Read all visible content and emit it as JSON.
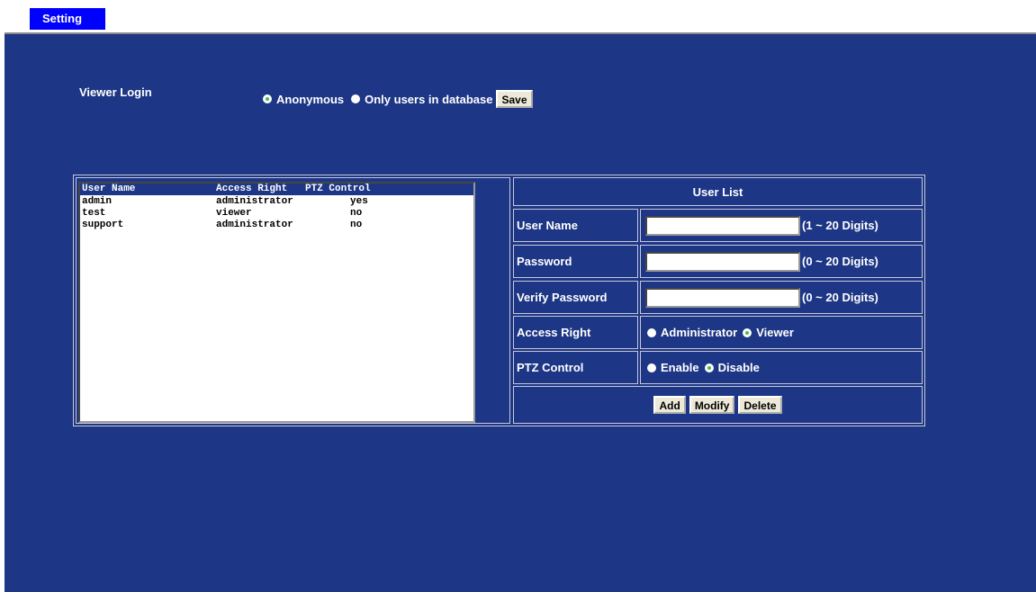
{
  "tabs": {
    "setting": "Setting"
  },
  "viewer_login": {
    "label": "Viewer Login",
    "options": [
      {
        "label": "Anonymous",
        "checked": true
      },
      {
        "label": "Only users in database",
        "checked": false
      }
    ],
    "save_label": "Save"
  },
  "user_table": {
    "headers": [
      "User Name",
      "Access Right",
      "PTZ Control"
    ],
    "rows": [
      [
        "admin",
        "administrator",
        "yes"
      ],
      [
        "test",
        "viewer",
        "no"
      ],
      [
        "support",
        "administrator",
        "no"
      ]
    ]
  },
  "user_list": {
    "title": "User List",
    "username": {
      "label": "User Name",
      "value": "",
      "hint": "(1 ~ 20 Digits)"
    },
    "password": {
      "label": "Password",
      "value": "",
      "hint": "(0 ~ 20 Digits)"
    },
    "verify_password": {
      "label": "Verify Password",
      "value": "",
      "hint": "(0 ~ 20 Digits)"
    },
    "access_right": {
      "label": "Access Right",
      "options": [
        {
          "label": "Administrator",
          "checked": false
        },
        {
          "label": "Viewer",
          "checked": true
        }
      ]
    },
    "ptz_control": {
      "label": "PTZ Control",
      "options": [
        {
          "label": "Enable",
          "checked": false
        },
        {
          "label": "Disable",
          "checked": true
        }
      ]
    },
    "buttons": {
      "add": "Add",
      "modify": "Modify",
      "delete": "Delete"
    }
  },
  "colors": {
    "background": "#1d3685",
    "tab_active": "#0000ff",
    "radio_selected": "#3ec244",
    "border": "#c8c8d8"
  }
}
